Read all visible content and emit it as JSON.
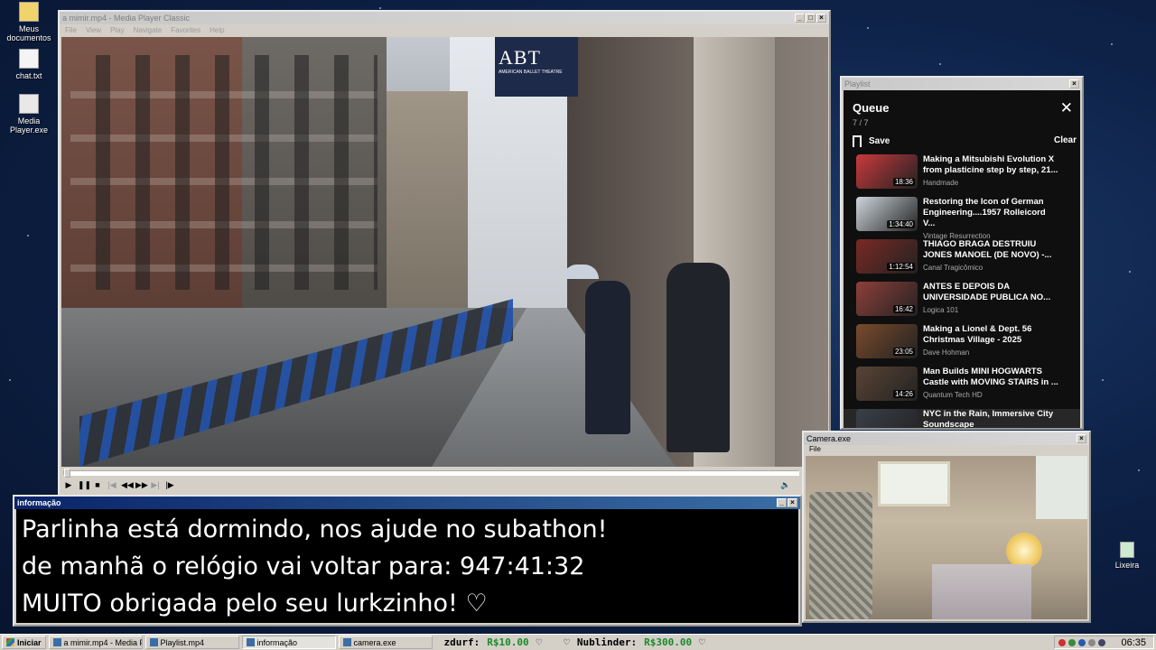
{
  "desktop": {
    "icons": [
      {
        "label": "Meus documentos",
        "icon": "folder-icon"
      },
      {
        "label": "chat.txt",
        "icon": "text-file-icon"
      },
      {
        "label": "Media Player.exe",
        "icon": "media-player-icon"
      }
    ],
    "recycle_bin": "Lixeira"
  },
  "media_player": {
    "title": "a mimir.mp4 - Media Player Classic",
    "menu": [
      "File",
      "View",
      "Play",
      "Navigate",
      "Favorites",
      "Help"
    ],
    "video_sign": "ABT",
    "video_sign_sub": "AMERICAN BALLET THEATRE",
    "controls": [
      "play-icon",
      "pause-icon",
      "stop-icon",
      "skip-back-icon",
      "rewind-icon",
      "fast-forward-icon",
      "skip-forward-icon",
      "frame-step-icon"
    ],
    "progress": 0.0
  },
  "playlist": {
    "window_title": "Playlist",
    "heading": "Queue",
    "count": "7 / 7",
    "save_label": "Save",
    "clear_label": "Clear",
    "items": [
      {
        "title": "Making a Mitsubishi Evolution X from plasticine step by step, 21...",
        "channel": "Handmade",
        "duration": "18:36",
        "color": "#c9393d"
      },
      {
        "title": "Restoring the Icon of German Engineering....1957 Rolleicord V...",
        "channel": "Vintage Resurrection",
        "duration": "1:34:40",
        "color": "#cfd6dc"
      },
      {
        "title": "THIAGO BRAGA DESTRUIU JONES MANOEL (DE NOVO) -...",
        "channel": "Canal Tragicômico",
        "duration": "1:12:54",
        "color": "#7a2a24"
      },
      {
        "title": "ANTES E DEPOIS DA UNIVERSIDADE PUBLICA NO...",
        "channel": "Logica 101",
        "duration": "16:42",
        "color": "#8f3f3a"
      },
      {
        "title": "Making a Lionel & Dept. 56 Christmas Village - 2025",
        "channel": "Dave Hohman",
        "duration": "23:05",
        "color": "#7a4a2c"
      },
      {
        "title": "Man Builds MINI HOGWARTS Castle with MOVING STAIRS in ...",
        "channel": "Quantum Tech HD",
        "duration": "14:26",
        "color": "#5a4436"
      },
      {
        "title": "NYC in the Rain, Immersive City Soundscape",
        "channel": "",
        "duration": "",
        "color": "#3a3f48"
      }
    ]
  },
  "info_window": {
    "title": "informação",
    "lines": [
      "Parlinha está dormindo, nos ajude no subathon!",
      "de manhã o relógio vai voltar para:  947:41:32",
      "MUITO obrigada pelo seu lurkzinho! ♡"
    ]
  },
  "camera": {
    "title": "Camera.exe",
    "menu": "File"
  },
  "taskbar": {
    "start": "Iniciar",
    "tasks": [
      {
        "label": "a mimir.mp4 - Media Playe...",
        "pressed": false
      },
      {
        "label": "Playlist.mp4",
        "pressed": false
      },
      {
        "label": "informação",
        "pressed": true
      },
      {
        "label": "camera.exe",
        "pressed": false
      }
    ],
    "ticker": [
      {
        "name": "zdurf:",
        "amount": "R$10.00",
        "heart": "♡"
      },
      {
        "name": "Nublinder:",
        "amount": "R$300.00",
        "heart": "♡"
      }
    ],
    "ticker_lead_heart": "♡",
    "clock": "06:35"
  }
}
